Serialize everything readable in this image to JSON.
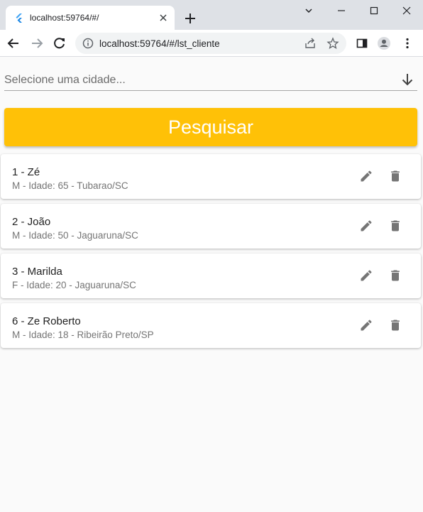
{
  "browser": {
    "tab_title": "localhost:59764/#/",
    "url": "localhost:59764/#/lst_cliente"
  },
  "app": {
    "city_select": {
      "placeholder": "Selecione uma cidade..."
    },
    "search_button": {
      "label": "Pesquisar",
      "color": "#ffc107"
    },
    "clients": [
      {
        "title": "1 - Zé",
        "subtitle": "M - Idade: 65 - Tubarao/SC"
      },
      {
        "title": "2 - João",
        "subtitle": "M - Idade: 50 - Jaguaruna/SC"
      },
      {
        "title": "3 - Marilda",
        "subtitle": "F - Idade: 20 - Jaguaruna/SC"
      },
      {
        "title": "6 - Ze Roberto",
        "subtitle": "M - Idade: 18 - Ribeirão Preto/SP"
      }
    ],
    "icons": {
      "edit": "edit-icon",
      "delete": "delete-icon"
    }
  }
}
